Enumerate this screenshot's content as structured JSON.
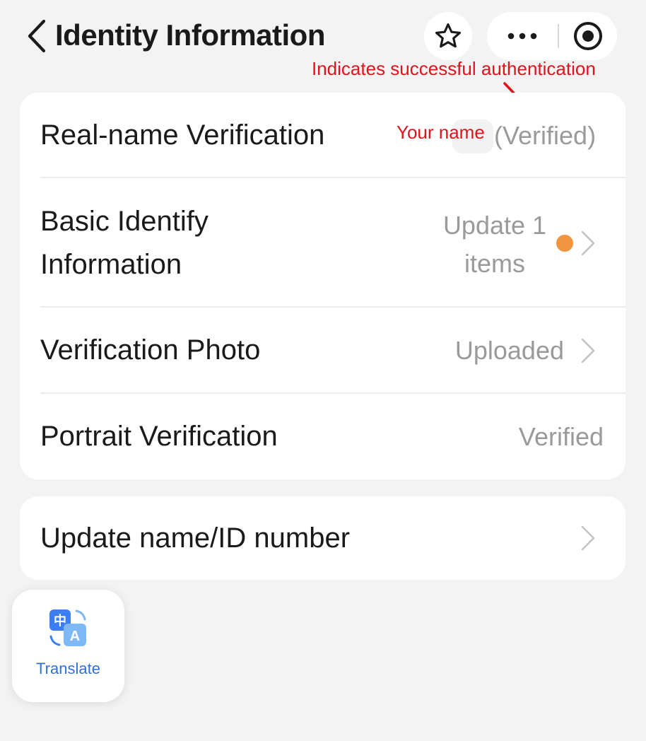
{
  "header": {
    "title": "Identity Information",
    "back_icon": "chevron-left-icon",
    "star_icon": "star-icon",
    "more_icon": "more-dots-icon",
    "close_icon": "record-circle-icon"
  },
  "annotation": {
    "text": "Indicates successful authentication",
    "name_hint": "Your name",
    "color": "#e0131c"
  },
  "identity_card": {
    "rows": [
      {
        "label": "Real-name Verification",
        "value": "(Verified)"
      },
      {
        "label": "Basic Identify Information",
        "value": "Update 1 items",
        "has_dot": true,
        "dot_color": "#f0953e"
      },
      {
        "label": "Verification Photo",
        "value": "Uploaded"
      },
      {
        "label": "Portrait Verification",
        "value": "Verified"
      }
    ]
  },
  "update_card": {
    "label": "Update name/ID number"
  },
  "translate": {
    "label": "Translate",
    "icon": "translate-icon",
    "accent": "#2f6fe0"
  }
}
